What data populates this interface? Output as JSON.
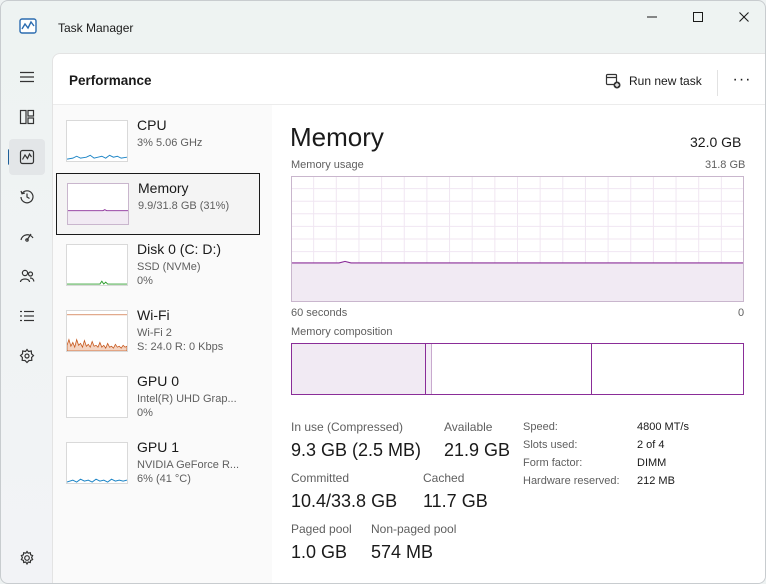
{
  "window": {
    "title": "Task Manager"
  },
  "header": {
    "title": "Performance",
    "run_new_task": "Run new task",
    "more": "···"
  },
  "nav": [
    "hamburger-icon",
    "processes-icon",
    "performance-icon",
    "app-history-icon",
    "startup-apps-icon",
    "users-icon",
    "details-icon",
    "services-icon",
    "settings-icon"
  ],
  "devices": [
    {
      "name": "CPU",
      "lines": [
        "3%  5.06 GHz"
      ]
    },
    {
      "name": "Memory",
      "lines": [
        "9.9/31.8 GB (31%)"
      ]
    },
    {
      "name": "Disk 0 (C: D:)",
      "lines": [
        "SSD (NVMe)",
        "0%"
      ]
    },
    {
      "name": "Wi-Fi",
      "lines": [
        "Wi-Fi 2",
        "S: 24.0  R: 0 Kbps"
      ]
    },
    {
      "name": "GPU 0",
      "lines": [
        "Intel(R) UHD Grap...",
        "0%"
      ]
    },
    {
      "name": "GPU 1",
      "lines": [
        "NVIDIA GeForce R...",
        "6%  (41 °C)"
      ]
    }
  ],
  "detail": {
    "title": "Memory",
    "total": "32.0 GB",
    "usage_label": "Memory usage",
    "usage_max": "31.8 GB",
    "time_left": "60 seconds",
    "time_right": "0",
    "usage_fraction": 0.31,
    "composition_label": "Memory composition",
    "stats": {
      "in_use_label": "In use (Compressed)",
      "in_use_value": "9.3 GB (2.5 MB)",
      "available_label": "Available",
      "available_value": "21.9 GB",
      "committed_label": "Committed",
      "committed_value": "10.4/33.8 GB",
      "cached_label": "Cached",
      "cached_value": "11.7 GB",
      "paged_label": "Paged pool",
      "paged_value": "1.0 GB",
      "nonpaged_label": "Non-paged pool",
      "nonpaged_value": "574 MB"
    },
    "specs": [
      {
        "label": "Speed:",
        "value": "4800 MT/s"
      },
      {
        "label": "Slots used:",
        "value": "2 of 4"
      },
      {
        "label": "Form factor:",
        "value": "DIMM"
      },
      {
        "label": "Hardware reserved:",
        "value": "212 MB"
      }
    ]
  },
  "colors": {
    "memory": "#8a2d98",
    "memory_fill": "#f1eaf3",
    "accent": "#1e5f99",
    "cpu": "#1d85c6",
    "disk": "#2e9e2e",
    "wifi": "#c5561b"
  }
}
